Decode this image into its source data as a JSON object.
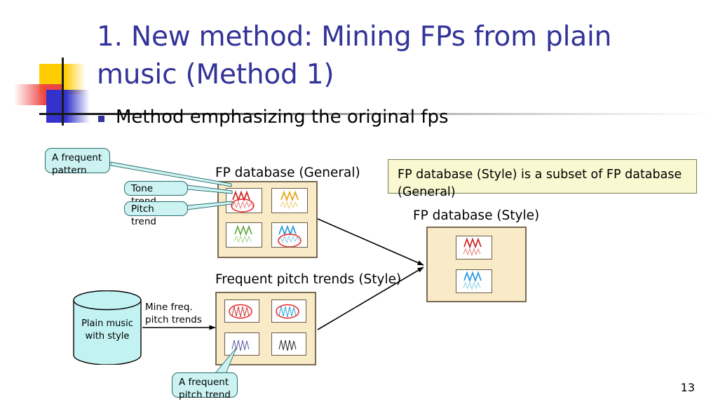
{
  "slide": {
    "title": "1. New method: Mining FPs from plain music (Method 1)",
    "bullet": "Method emphasizing the original fps",
    "page_number": "13",
    "title_color": "#333399"
  },
  "labels": {
    "fp_db_general": "FP database (General)",
    "fp_db_style": "FP database (Style)",
    "frequent_pitch_trends_style": "Frequent pitch trends (Style)",
    "mine_freq_pitch_trends": "Mine freq.\npitch trends"
  },
  "note": {
    "text": "FP database (Style) is a subset of FP database (General)"
  },
  "callouts": [
    {
      "name": "a-frequent-pattern",
      "text": "A frequent\npattern"
    },
    {
      "name": "tone-trend",
      "text": "Tone trend"
    },
    {
      "name": "pitch-trend",
      "text": "Pitch trend"
    },
    {
      "name": "a-frequent-pitch-trend",
      "text": "A frequent\npitch trend"
    }
  ],
  "cylinder": {
    "label": "Plain music\nwith style",
    "fill": "#C3F2F2"
  },
  "fp_db_general": {
    "cards": [
      {
        "name": "card-red",
        "tone_color": "#CC2222",
        "pitch_color": "#E88080",
        "has_tone": true,
        "circled": true
      },
      {
        "name": "card-orange",
        "tone_color": "#E8A317",
        "pitch_color": "#F0CC7A",
        "has_tone": true,
        "circled": false
      },
      {
        "name": "card-green",
        "tone_color": "#66AA44",
        "pitch_color": "#A8D48C",
        "has_tone": true,
        "circled": false
      },
      {
        "name": "card-blue",
        "tone_color": "#2299DD",
        "pitch_color": "#88CCEE",
        "has_tone": true,
        "circled": true
      }
    ]
  },
  "fp_db_style": {
    "cards": [
      {
        "name": "card-red",
        "tone_color": "#CC2222",
        "pitch_color": "#E88080",
        "has_tone": true,
        "circled": false
      },
      {
        "name": "card-blue",
        "tone_color": "#2299DD",
        "pitch_color": "#88CCEE",
        "has_tone": true,
        "circled": false
      }
    ]
  },
  "frequent_pitch_trends": {
    "cards": [
      {
        "name": "card-red",
        "pitch_color": "#CC4444",
        "has_tone": false,
        "circled": true
      },
      {
        "name": "card-blue",
        "pitch_color": "#33AADD",
        "has_tone": false,
        "circled": true
      },
      {
        "name": "card-purple",
        "pitch_color": "#6666AA",
        "has_tone": false,
        "circled": false
      },
      {
        "name": "card-black",
        "pitch_color": "#333333",
        "has_tone": false,
        "circled": false
      }
    ]
  },
  "colors": {
    "box_fill": "#FAEBC8",
    "box_border": "#7A6A52",
    "note_fill": "#FAF8D0",
    "callout_fill": "#CCF2F2",
    "circle_highlight": "#EE2222"
  }
}
